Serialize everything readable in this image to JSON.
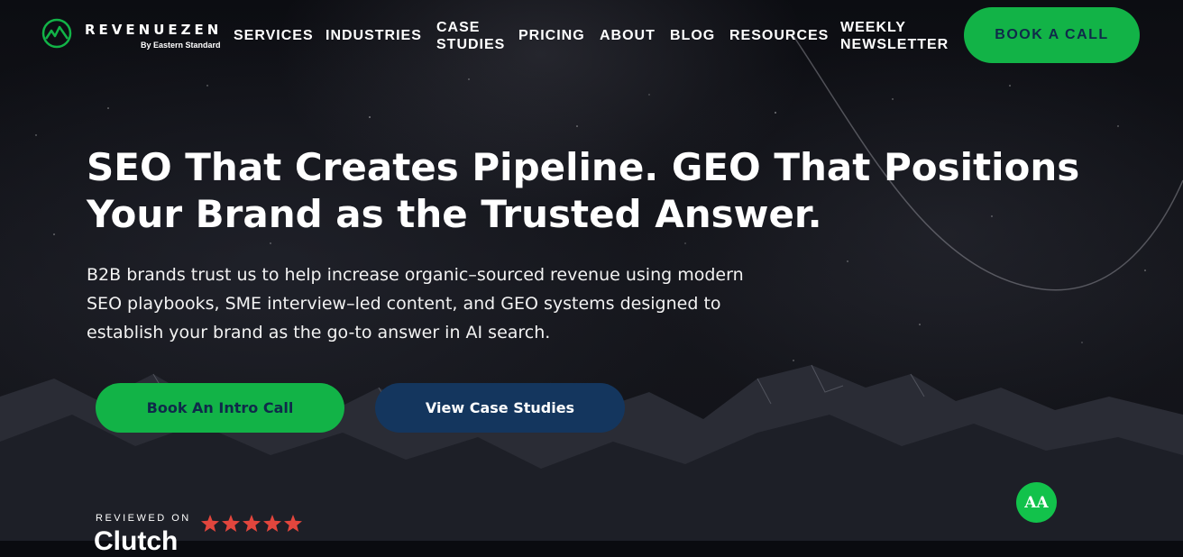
{
  "brand": {
    "name": "REVENUEZEN",
    "tagline": "By Eastern Standard",
    "accent_color": "#12b347",
    "navy_color": "#14365e"
  },
  "nav": {
    "items": [
      {
        "label": "SERVICES"
      },
      {
        "label": "INDUSTRIES"
      },
      {
        "label": "CASE STUDIES"
      },
      {
        "label": "PRICING"
      },
      {
        "label": "ABOUT"
      },
      {
        "label": "BLOG"
      },
      {
        "label": "RESOURCES"
      },
      {
        "label": "WEEKLY NEWSLETTER"
      }
    ],
    "cta_label": "BOOK A CALL"
  },
  "hero": {
    "title": "SEO That Creates Pipeline. GEO That Positions Your Brand as the Trusted Answer.",
    "subtitle": "B2B brands trust us to help increase organic–sourced revenue using modern SEO playbooks, SME interview–led content, and GEO systems designed to establish your brand as the go-to answer in AI search.",
    "primary_button": "Book An Intro Call",
    "secondary_button": "View Case Studies"
  },
  "review": {
    "label": "REVIEWED ON",
    "platform": "Clutch",
    "rating": 5,
    "star_color": "#e2463d"
  },
  "accessibility": {
    "icon": "accessibility-text-size-icon",
    "label": "AA"
  }
}
